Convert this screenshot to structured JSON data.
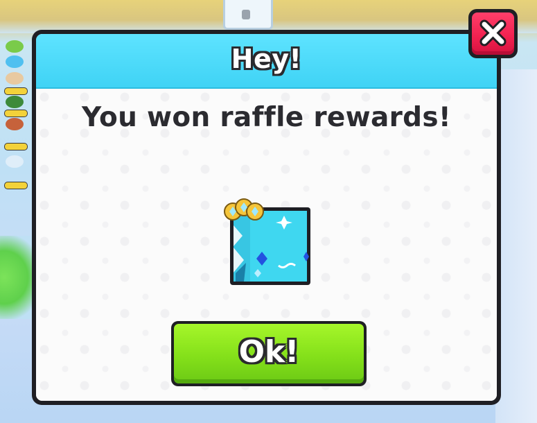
{
  "dialog": {
    "title": "Hey!",
    "message": "You won raffle rewards!",
    "confirm_label": "Ok!",
    "close_icon": "close-icon",
    "reward_icon": "enchant-book-icon"
  },
  "colors": {
    "header": "#4fdcf9",
    "confirm_button": "#8ee41f",
    "close_button": "#f0204f",
    "text_dark": "#2b2b30"
  }
}
